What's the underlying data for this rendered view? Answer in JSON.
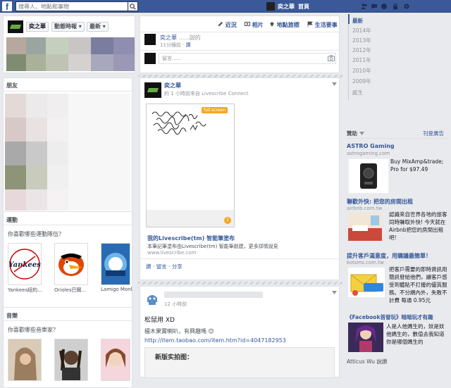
{
  "topbar": {
    "search_placeholder": "搜尋人、地點和事物",
    "user_name": "奕之華",
    "home": "首頁"
  },
  "profile_header": {
    "name": "奕之華",
    "feed_button": "動態時報",
    "sort_button": "最新",
    "tabs": [
      "近況",
      "相片",
      "地點旅標",
      "生活要事"
    ]
  },
  "left": {
    "friends_heading": "朋友",
    "sports_heading": "運動",
    "sports_question": "你喜歡哪些運動隊伍？",
    "teams": [
      "Yankees紐約...",
      "Orioles巴爾...",
      "Lamigo Monk..."
    ],
    "music_heading": "音樂",
    "music_question": "你喜歡哪些音樂家？"
  },
  "center": {
    "top_post": {
      "name": "奕之華",
      "time": "11分鐘前",
      "action": "讚",
      "blur": "......說的"
    },
    "composer_placeholder": "留言......",
    "post1": {
      "name": "奕之華",
      "meta": "約 1 小時前來自 Livescribe Connect",
      "badge": "full screen",
      "counter": "2",
      "link_title": "我的Livescribe(tm) 智能筆塗布",
      "link_desc": "本筆記筆塗布由Livescribe(tm) 智能筆創建，更多詳情說見",
      "link_url": "www.livescribe.com",
      "actions": [
        "讚",
        "留言",
        "分享"
      ]
    },
    "post2": {
      "time": "12 小時前",
      "text": "松鼠用 XD",
      "line2": "檀木果實喇叭，有興趣嗎 😊",
      "url": "http://item.taobao.com/item.htm?id=4047182953",
      "photo_caption": "新版实拍图："
    }
  },
  "right": {
    "timeline_items": [
      "最新",
      "2014年",
      "2013年",
      "2012年",
      "2011年",
      "2010年",
      "2009年",
      "誕生"
    ],
    "sponsored": "贊助",
    "create_ad": "刊登廣告",
    "ads": [
      {
        "title": "ASTRO Gaming",
        "url": "astrogaming.com",
        "body": "Buy MixAmp&trade; Pro for $97.49"
      },
      {
        "title": "聯歡外快: 把您的房間出租",
        "url": "airbnb.com.tw",
        "body": "認識來自世界各地的旅客同時賺取外快! 今天就在Airbnb把您的房間出租吧!"
      },
      {
        "title": "提升客戶滿意度，用購議最簡單！",
        "url": "kotsms.com.tw",
        "body": "把客戶需要的即時資訊用簡訊發給他們，讓客戶感受到體貼不打擾的優質服務。不分網內外，失敗不計費 每通 0.95元"
      },
      {
        "title": "《Facebook首發玩》暗暗玩才有趣",
        "url": "",
        "body": "人是人他媽生的，妖是妖他媽生的，數值去我知道你是哪個媽生的"
      }
    ],
    "ad_footer": "Atticus Wu 說讚"
  },
  "colors": {
    "brand": "#3b5998",
    "link": "#365899",
    "page_bg": "#e9eaed"
  }
}
